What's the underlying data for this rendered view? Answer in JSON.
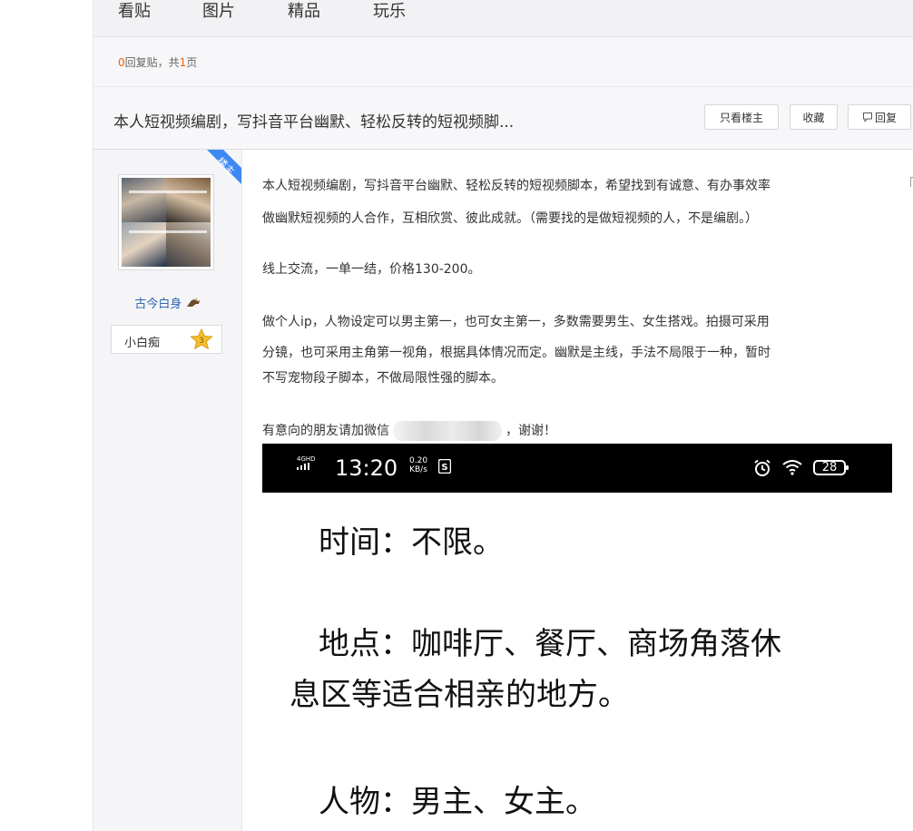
{
  "tabs": [
    {
      "label": "看贴"
    },
    {
      "label": "图片"
    },
    {
      "label": "精品"
    },
    {
      "label": "玩乐"
    }
  ],
  "reply_info": {
    "count": "0",
    "text_mid": "回复贴，共",
    "pages": "1",
    "text_end": "页"
  },
  "thread": {
    "title": "本人短视频编剧，写抖音平台幽默、轻松反转的短视频脚...",
    "buttons": {
      "only_op": "只看楼主",
      "favorite": "收藏",
      "reply": "回复"
    }
  },
  "author": {
    "badge": "楼主",
    "username": "古今白身",
    "level_name": "小白痴",
    "level_num": "3"
  },
  "post": {
    "line1": "本人短视频编剧，写抖音平台幽默、轻松反转的短视频脚本，希望找到有诚意、有办事效率",
    "line2": "做幽默短视频的人合作，互相欣赏、彼此成就。（需要找的是做短视频的人，不是编剧。）",
    "line3": "线上交流，一单一结，价格130-200。",
    "line4": "做个人ip，人物设定可以男主第一，也可女主第一，多数需要男生、女生搭戏。拍摄可采用",
    "line5": "分镜，也可采用主角第一视角，根据具体情况而定。幽默是主线，手法不局限于一种，暂时",
    "line6": "不写宠物段子脚本，不做局限性强的脚本。",
    "line7_pre": "有意向的朋友请加微信",
    "line7_post": "，谢谢！"
  },
  "screenshot": {
    "signal": "4GHD",
    "time": "13:20",
    "speed_top": "0.20",
    "speed_bottom": "KB/s",
    "battery": "28",
    "line1": "时间：不限。",
    "line2": "地点：咖啡厅、餐厅、商场角落休",
    "line3": "息区等适合相亲的地方。",
    "line4": "人物：男主、女主。"
  },
  "colors": {
    "accent_blue": "#3d88f2",
    "link_blue": "#2d64b3",
    "reply_count_orange": "#f06000"
  }
}
